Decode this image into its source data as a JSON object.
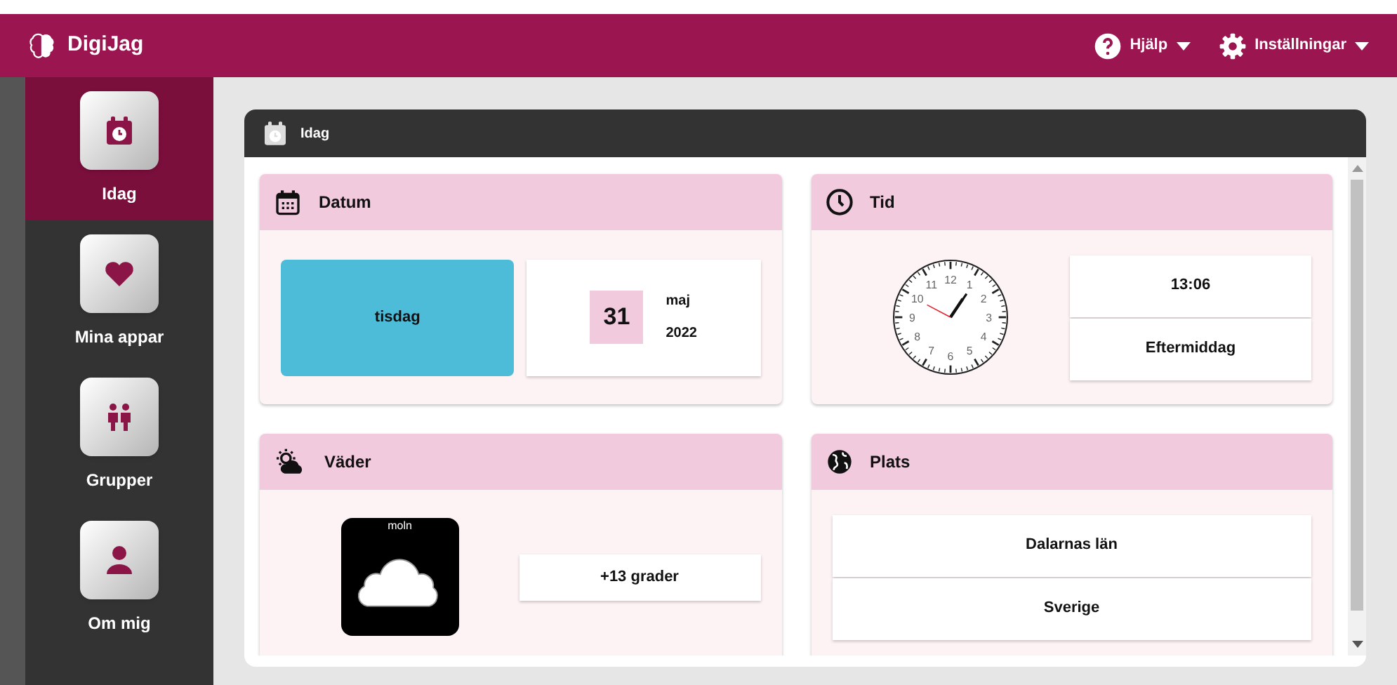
{
  "app": {
    "name": "DigiJag"
  },
  "header_menus": [
    {
      "kind": "help",
      "label": "Hjälp"
    },
    {
      "kind": "settings",
      "label": "Inställningar"
    }
  ],
  "sidebar": {
    "items": [
      {
        "kind": "today",
        "label": "Idag",
        "selected": true
      },
      {
        "kind": "heart",
        "label": "Mina appar",
        "selected": false
      },
      {
        "kind": "group",
        "label": "Grupper",
        "selected": false
      },
      {
        "kind": "person",
        "label": "Om mig",
        "selected": false
      }
    ]
  },
  "panel": {
    "title": "Idag"
  },
  "date_card": {
    "title": "Datum",
    "weekday": "tisdag",
    "day": "31",
    "month": "maj",
    "year": "2022"
  },
  "time_card": {
    "title": "Tid",
    "dial_numbers": [
      "11",
      "12",
      "1",
      "10",
      "2",
      "9",
      "3",
      "8",
      "4",
      "7",
      "5",
      "6"
    ],
    "time": "13:06",
    "period": "Eftermiddag"
  },
  "weather_card": {
    "title": "Väder",
    "pictogram_label": "moln",
    "temperature": "+13 grader"
  },
  "place_card": {
    "title": "Plats",
    "region": "Dalarnas län",
    "country": "Sverige"
  }
}
